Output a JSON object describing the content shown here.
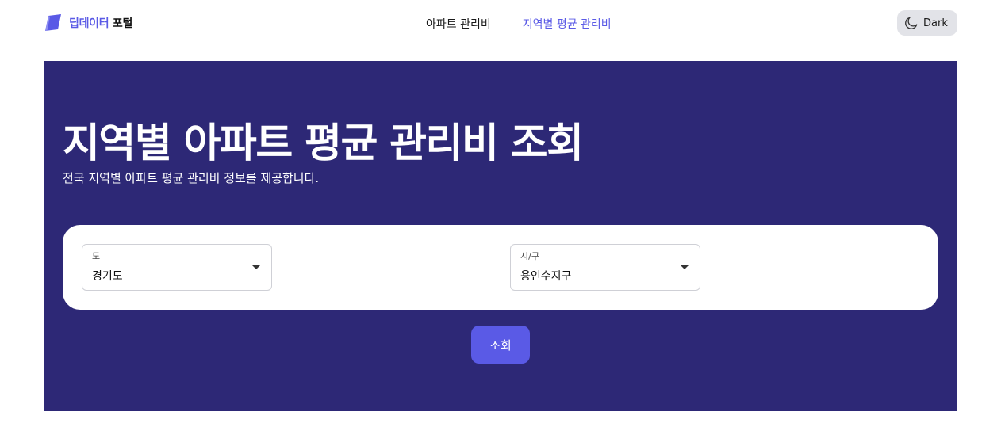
{
  "brand": {
    "accent": "딥데이터",
    "rest": "포털",
    "color": "#5a5ae6"
  },
  "nav": {
    "items": [
      {
        "label": "아파트 관리비",
        "active": false
      },
      {
        "label": "지역별 평균 관리비",
        "active": true
      }
    ]
  },
  "theme_toggle": {
    "label": "Dark",
    "icon": "moon-icon"
  },
  "hero": {
    "title": "지역별 아파트 평균 관리비 조회",
    "subtitle": "전국 지역별 아파트 평균 관리비 정보를 제공합니다.",
    "background": "#2d2876"
  },
  "filters": {
    "province": {
      "label": "도",
      "value": "경기도"
    },
    "city": {
      "label": "시/구",
      "value": "용인수지구"
    }
  },
  "search_button": {
    "label": "조회",
    "color": "#5a5ae6"
  }
}
